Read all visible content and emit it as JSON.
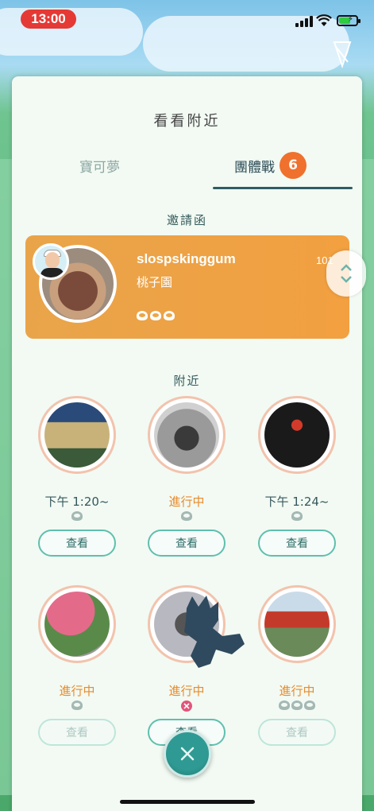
{
  "status_bar": {
    "time": "13:00",
    "time_color": "#e53935"
  },
  "panel": {
    "title": "看看附近",
    "tabs": [
      {
        "label": "寶可夢",
        "active": false
      },
      {
        "label": "團體戰",
        "active": true,
        "badge": "6",
        "badge_color": "#f0702d"
      }
    ]
  },
  "invites": {
    "heading": "邀請函",
    "card": {
      "trainer": "slospskinggum",
      "location": "桃子園",
      "level": "101",
      "tier_icons": 3,
      "color": "#f2a040"
    }
  },
  "nearby": {
    "heading": "附近",
    "raids": [
      {
        "status": "下午 1:20~",
        "state": "upcoming",
        "tier_icons": 1,
        "button": "查看"
      },
      {
        "status": "進行中",
        "state": "live",
        "tier_icons": 1,
        "button": "查看"
      },
      {
        "status": "下午 1:24~",
        "state": "upcoming",
        "tier_icons": 1,
        "button": "查看"
      },
      {
        "status": "進行中",
        "state": "live",
        "tier_icons": 1,
        "button": "查看"
      },
      {
        "status": "進行中",
        "state": "live",
        "tier_icons": 1,
        "special_icon": "mega-raid-icon",
        "button": "查看"
      },
      {
        "status": "進行中",
        "state": "live",
        "tier_icons": 3,
        "button": "查看"
      }
    ]
  },
  "colors": {
    "accent": "#5fbfae",
    "live": "#e88b2e",
    "panel_bg": "#f2faf3"
  }
}
